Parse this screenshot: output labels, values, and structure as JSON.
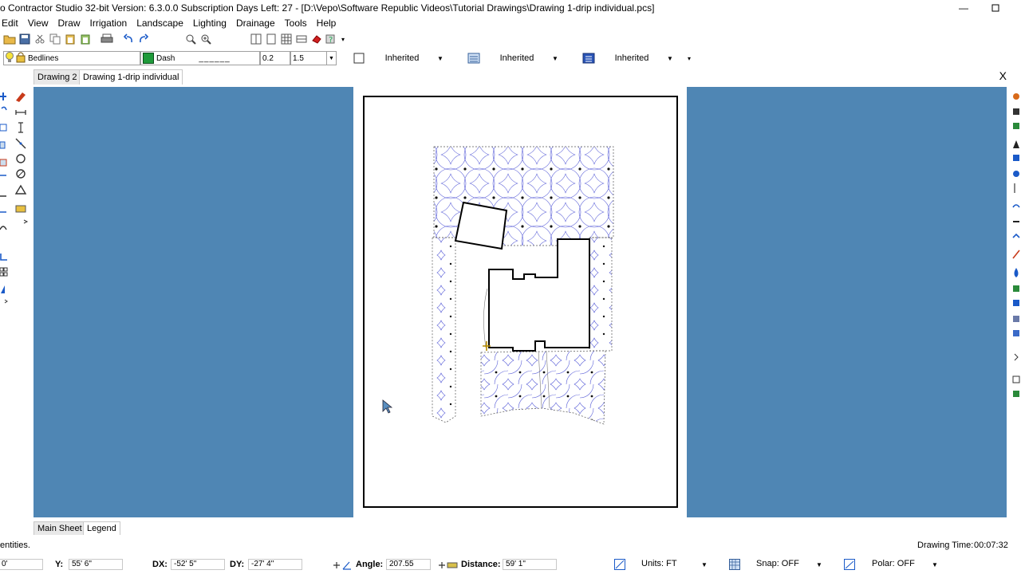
{
  "window": {
    "title": "o Contractor Studio 32-bit   Version: 6.3.0.0   Subscription Days Left: 27 - [D:\\Vepo\\Software Republic Videos\\Tutorial Drawings\\Drawing 1-drip individual.pcs]"
  },
  "menu": [
    "Edit",
    "View",
    "Draw",
    "Irrigation",
    "Landscape",
    "Lighting",
    "Drainage",
    "Tools",
    "Help"
  ],
  "props": {
    "layer": "Bedlines",
    "linetype": "Dash",
    "linepattern": "______",
    "width1": "0.2",
    "width2": "1.5",
    "combo1": "Inherited",
    "combo2": "Inherited",
    "combo3": "Inherited"
  },
  "colors": {
    "layer_swatch": "#1f9a3a",
    "canvas_bg": "#4f86b4"
  },
  "tabs": [
    "Drawing 2",
    "Drawing 1-drip individual"
  ],
  "close_label": "X",
  "sheet_tabs": [
    "Main Sheet",
    "Legend"
  ],
  "status": {
    "message": "entities.",
    "drawing_time_label": "Drawing Time:",
    "drawing_time": "00:07:32",
    "x_val": "0'",
    "y_label": "Y:",
    "y_val": "55' 6\"",
    "dx_label": "DX:",
    "dx_val": "-52' 5\"",
    "dy_label": "DY:",
    "dy_val": "-27' 4\"",
    "angle_label": "Angle:",
    "angle_val": "207.55",
    "distance_label": "Distance:",
    "distance_val": "59' 1\"",
    "units": "Units: FT",
    "snap": "Snap: OFF",
    "polar": "Polar: OFF"
  }
}
